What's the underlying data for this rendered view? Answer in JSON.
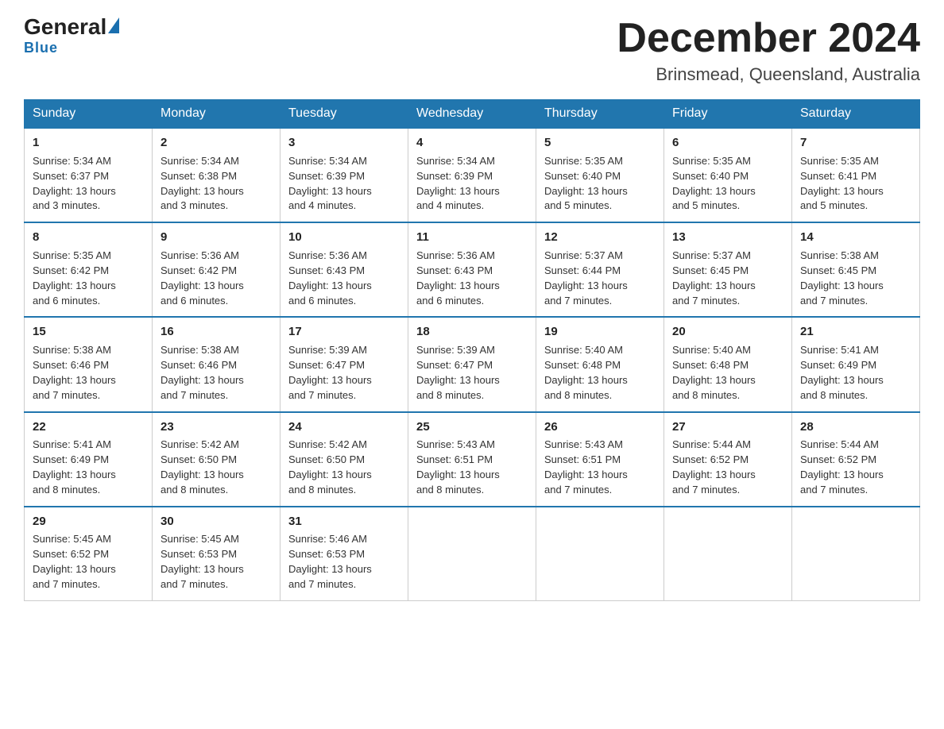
{
  "header": {
    "logo_general": "General",
    "logo_blue": "Blue",
    "main_title": "December 2024",
    "subtitle": "Brinsmead, Queensland, Australia"
  },
  "days_of_week": [
    "Sunday",
    "Monday",
    "Tuesday",
    "Wednesday",
    "Thursday",
    "Friday",
    "Saturday"
  ],
  "weeks": [
    [
      {
        "day": "1",
        "sunrise": "5:34 AM",
        "sunset": "6:37 PM",
        "daylight": "13 hours and 3 minutes."
      },
      {
        "day": "2",
        "sunrise": "5:34 AM",
        "sunset": "6:38 PM",
        "daylight": "13 hours and 3 minutes."
      },
      {
        "day": "3",
        "sunrise": "5:34 AM",
        "sunset": "6:39 PM",
        "daylight": "13 hours and 4 minutes."
      },
      {
        "day": "4",
        "sunrise": "5:34 AM",
        "sunset": "6:39 PM",
        "daylight": "13 hours and 4 minutes."
      },
      {
        "day": "5",
        "sunrise": "5:35 AM",
        "sunset": "6:40 PM",
        "daylight": "13 hours and 5 minutes."
      },
      {
        "day": "6",
        "sunrise": "5:35 AM",
        "sunset": "6:40 PM",
        "daylight": "13 hours and 5 minutes."
      },
      {
        "day": "7",
        "sunrise": "5:35 AM",
        "sunset": "6:41 PM",
        "daylight": "13 hours and 5 minutes."
      }
    ],
    [
      {
        "day": "8",
        "sunrise": "5:35 AM",
        "sunset": "6:42 PM",
        "daylight": "13 hours and 6 minutes."
      },
      {
        "day": "9",
        "sunrise": "5:36 AM",
        "sunset": "6:42 PM",
        "daylight": "13 hours and 6 minutes."
      },
      {
        "day": "10",
        "sunrise": "5:36 AM",
        "sunset": "6:43 PM",
        "daylight": "13 hours and 6 minutes."
      },
      {
        "day": "11",
        "sunrise": "5:36 AM",
        "sunset": "6:43 PM",
        "daylight": "13 hours and 6 minutes."
      },
      {
        "day": "12",
        "sunrise": "5:37 AM",
        "sunset": "6:44 PM",
        "daylight": "13 hours and 7 minutes."
      },
      {
        "day": "13",
        "sunrise": "5:37 AM",
        "sunset": "6:45 PM",
        "daylight": "13 hours and 7 minutes."
      },
      {
        "day": "14",
        "sunrise": "5:38 AM",
        "sunset": "6:45 PM",
        "daylight": "13 hours and 7 minutes."
      }
    ],
    [
      {
        "day": "15",
        "sunrise": "5:38 AM",
        "sunset": "6:46 PM",
        "daylight": "13 hours and 7 minutes."
      },
      {
        "day": "16",
        "sunrise": "5:38 AM",
        "sunset": "6:46 PM",
        "daylight": "13 hours and 7 minutes."
      },
      {
        "day": "17",
        "sunrise": "5:39 AM",
        "sunset": "6:47 PM",
        "daylight": "13 hours and 7 minutes."
      },
      {
        "day": "18",
        "sunrise": "5:39 AM",
        "sunset": "6:47 PM",
        "daylight": "13 hours and 8 minutes."
      },
      {
        "day": "19",
        "sunrise": "5:40 AM",
        "sunset": "6:48 PM",
        "daylight": "13 hours and 8 minutes."
      },
      {
        "day": "20",
        "sunrise": "5:40 AM",
        "sunset": "6:48 PM",
        "daylight": "13 hours and 8 minutes."
      },
      {
        "day": "21",
        "sunrise": "5:41 AM",
        "sunset": "6:49 PM",
        "daylight": "13 hours and 8 minutes."
      }
    ],
    [
      {
        "day": "22",
        "sunrise": "5:41 AM",
        "sunset": "6:49 PM",
        "daylight": "13 hours and 8 minutes."
      },
      {
        "day": "23",
        "sunrise": "5:42 AM",
        "sunset": "6:50 PM",
        "daylight": "13 hours and 8 minutes."
      },
      {
        "day": "24",
        "sunrise": "5:42 AM",
        "sunset": "6:50 PM",
        "daylight": "13 hours and 8 minutes."
      },
      {
        "day": "25",
        "sunrise": "5:43 AM",
        "sunset": "6:51 PM",
        "daylight": "13 hours and 8 minutes."
      },
      {
        "day": "26",
        "sunrise": "5:43 AM",
        "sunset": "6:51 PM",
        "daylight": "13 hours and 7 minutes."
      },
      {
        "day": "27",
        "sunrise": "5:44 AM",
        "sunset": "6:52 PM",
        "daylight": "13 hours and 7 minutes."
      },
      {
        "day": "28",
        "sunrise": "5:44 AM",
        "sunset": "6:52 PM",
        "daylight": "13 hours and 7 minutes."
      }
    ],
    [
      {
        "day": "29",
        "sunrise": "5:45 AM",
        "sunset": "6:52 PM",
        "daylight": "13 hours and 7 minutes."
      },
      {
        "day": "30",
        "sunrise": "5:45 AM",
        "sunset": "6:53 PM",
        "daylight": "13 hours and 7 minutes."
      },
      {
        "day": "31",
        "sunrise": "5:46 AM",
        "sunset": "6:53 PM",
        "daylight": "13 hours and 7 minutes."
      },
      null,
      null,
      null,
      null
    ]
  ],
  "labels": {
    "sunrise": "Sunrise:",
    "sunset": "Sunset:",
    "daylight": "Daylight:"
  }
}
